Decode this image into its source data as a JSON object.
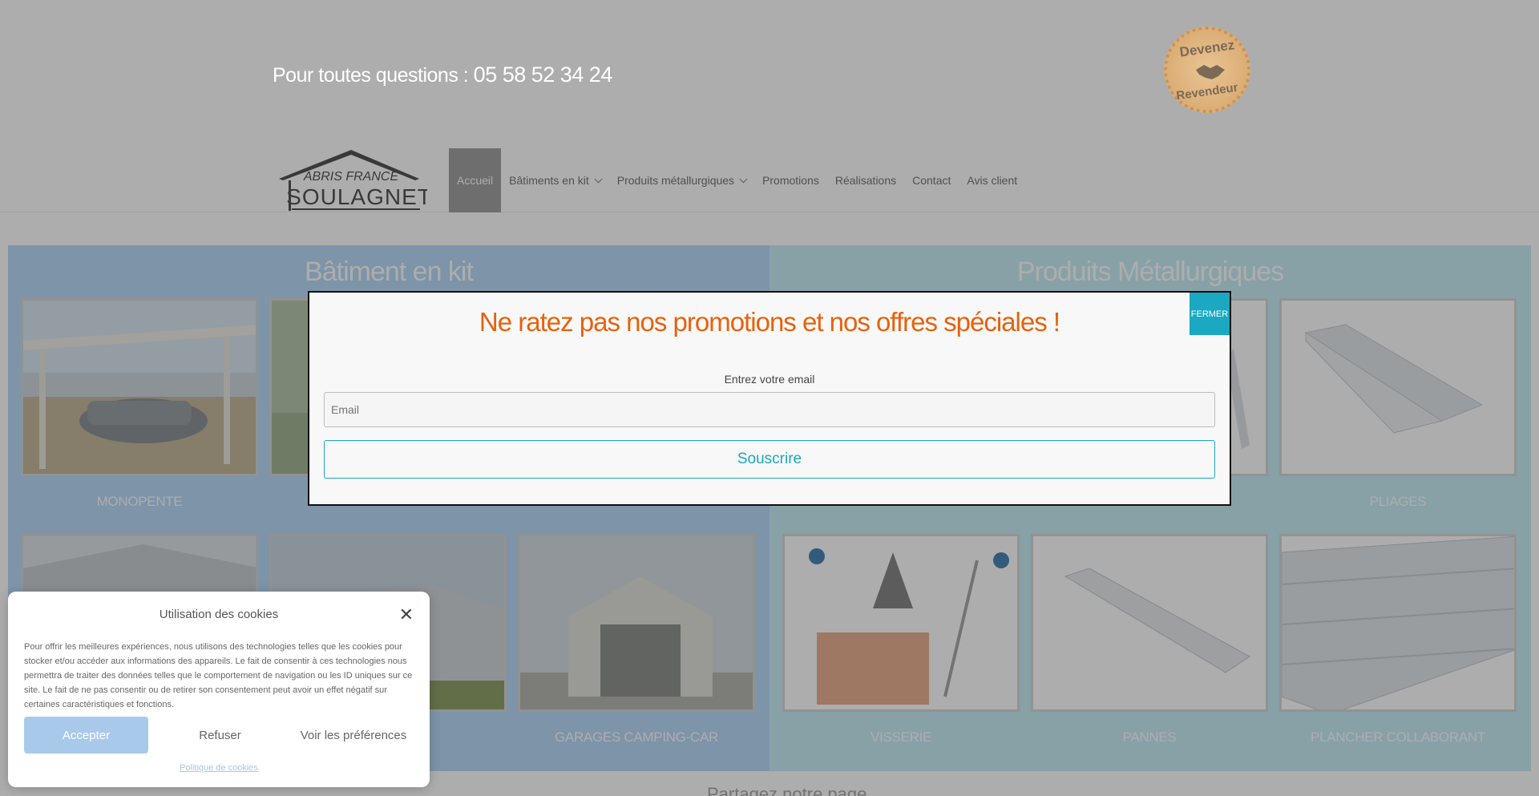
{
  "header": {
    "phone_prefix": "Pour toutes questions : ",
    "phone_number": "05 58 52 34 24",
    "seal_top": "Devenez",
    "seal_bottom": "Revendeur"
  },
  "logo": {
    "line1": "ABRIS FRANCE",
    "line2": "SOULAGNET"
  },
  "nav": {
    "items": [
      "Accueil",
      "Bâtiments en kit",
      "Produits métallurgiques",
      "Promotions",
      "Réalisations",
      "Contact",
      "Avis client"
    ]
  },
  "sections": {
    "left_title": "Bâtiment en kit",
    "right_title": "Produits Métallurgiques",
    "left_row1_labels": [
      "MONOPENTE",
      "",
      ""
    ],
    "left_row2_labels": [
      "",
      "",
      "GARAGES CAMPING-CAR"
    ],
    "right_row1_labels": [
      "",
      "",
      "PLIAGES"
    ],
    "right_row2_labels": [
      "VISSERIE",
      "PANNES",
      "PLANCHER COLLABORANT"
    ]
  },
  "modal": {
    "title": "Ne ratez pas nos promotions et nos offres spéciales !",
    "close_label": "FERMER",
    "email_label": "Entrez votre email",
    "email_placeholder": "Email",
    "submit_label": "Souscrire"
  },
  "cookie": {
    "title": "Utilisation des cookies",
    "body": "Pour offrir les meilleures expériences, nous utilisons des technologies telles que les cookies pour stocker et/ou accéder aux informations des appareils. Le fait de consentir à ces technologies nous permettra de traiter des données telles que le comportement de navigation ou les ID uniques sur ce site. Le fait de ne pas consentir ou de retirer son consentement peut avoir un effet négatif sur certaines caractéristiques et fonctions.",
    "accept": "Accepter",
    "refuse": "Refuser",
    "prefs": "Voir les préférences",
    "policy": "Politique de cookies"
  },
  "footer_partial": "Partagez notre page",
  "colors": {
    "modal_title": "#e8620c",
    "accent": "#1aa8c2",
    "left_section": "#b9daf9",
    "right_section": "#c8eef7",
    "accept_button": "#a9c9ea"
  }
}
